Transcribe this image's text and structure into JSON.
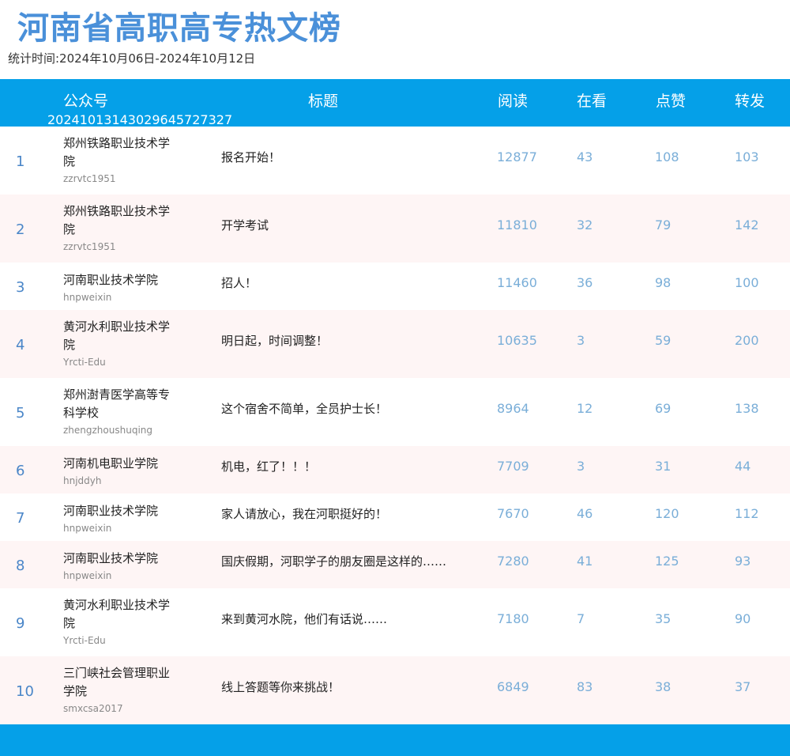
{
  "page": {
    "title": "河南省高职高专热文榜",
    "period": "统计时间:2024年10月06日-2024年10月12日"
  },
  "table": {
    "headers": {
      "account": "公众号",
      "title": "标题",
      "reads": "阅读",
      "watching": "在看",
      "likes": "点赞",
      "shares": "转发"
    },
    "code": "20241013143029645727327",
    "rows": [
      {
        "rank": "1",
        "name": "郑州铁路职业技术学院",
        "id": "zzrvtc1951",
        "title": "报名开始！",
        "reads": "12877",
        "watching": "43",
        "likes": "108",
        "shares": "103"
      },
      {
        "rank": "2",
        "name": "郑州铁路职业技术学院",
        "id": "zzrvtc1951",
        "title": "开学考试",
        "reads": "11810",
        "watching": "32",
        "likes": "79",
        "shares": "142"
      },
      {
        "rank": "3",
        "name": "河南职业技术学院",
        "id": "hnpweixin",
        "title": "招人！",
        "reads": "11460",
        "watching": "36",
        "likes": "98",
        "shares": "100"
      },
      {
        "rank": "4",
        "name": "黄河水利职业技术学院",
        "id": "Yrcti-Edu",
        "title": "明日起，时间调整！",
        "reads": "10635",
        "watching": "3",
        "likes": "59",
        "shares": "200"
      },
      {
        "rank": "5",
        "name": "郑州澍青医学高等专科学校",
        "id": "zhengzhoushuqing",
        "title": "这个宿舍不简单，全员护士长！",
        "reads": "8964",
        "watching": "12",
        "likes": "69",
        "shares": "138"
      },
      {
        "rank": "6",
        "name": "河南机电职业学院",
        "id": "hnjddyh",
        "title": "机电，红了！！！",
        "reads": "7709",
        "watching": "3",
        "likes": "31",
        "shares": "44"
      },
      {
        "rank": "7",
        "name": "河南职业技术学院",
        "id": "hnpweixin",
        "title": "家人请放心，我在河职挺好的！",
        "reads": "7670",
        "watching": "46",
        "likes": "120",
        "shares": "112"
      },
      {
        "rank": "8",
        "name": "河南职业技术学院",
        "id": "hnpweixin",
        "title": "国庆假期，河职学子的朋友圈是这样的……",
        "reads": "7280",
        "watching": "41",
        "likes": "125",
        "shares": "93"
      },
      {
        "rank": "9",
        "name": "黄河水利职业技术学院",
        "id": "Yrcti-Edu",
        "title": "来到黄河水院，他们有话说……",
        "reads": "7180",
        "watching": "7",
        "likes": "35",
        "shares": "90"
      },
      {
        "rank": "10",
        "name": "三门峡社会管理职业学院",
        "id": "smxcsa2017",
        "title": "线上答题等你来挑战！",
        "reads": "6849",
        "watching": "83",
        "likes": "38",
        "shares": "37"
      }
    ]
  },
  "colors": {
    "title": "#4a90d9",
    "header_bg": "#05a0e8",
    "alt_row_bg": "#fef5f5",
    "rank": "#4a86c8",
    "numbers": "#7aaed8"
  }
}
